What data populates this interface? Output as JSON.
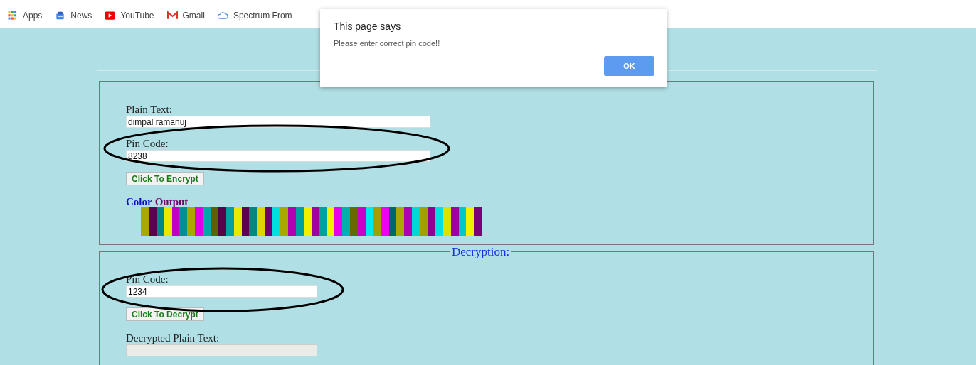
{
  "bookmarks_bar": {
    "items": [
      {
        "label": "Apps",
        "kind": "grid"
      },
      {
        "label": "News",
        "kind": "news"
      },
      {
        "label": "YouTube",
        "kind": "play"
      },
      {
        "label": "Gmail",
        "kind": "mail"
      },
      {
        "label": "Spectrum From",
        "kind": "cloud"
      }
    ]
  },
  "encryption": {
    "plain_text_label": "Plain Text:",
    "plain_text_value": "dimpal ramanuj",
    "pin_label": "Pin Code:",
    "pin_value": "8238",
    "button": "Click To Encrypt",
    "output_title_1": "Color",
    "output_title_2": "Output",
    "stripes": [
      {
        "color": "#a8a800"
      },
      {
        "color": "#5c0050"
      },
      {
        "color": "#008888"
      },
      {
        "color": "#e8e800"
      },
      {
        "color": "#c000c0"
      },
      {
        "color": "#009090"
      },
      {
        "color": "#a8a800"
      },
      {
        "color": "#e000e0"
      },
      {
        "color": "#00a8a8"
      },
      {
        "color": "#606000"
      },
      {
        "color": "#580048"
      },
      {
        "color": "#00a0a0"
      },
      {
        "color": "#e8e800"
      },
      {
        "color": "#600050"
      },
      {
        "color": "#008880"
      },
      {
        "color": "#d8d800"
      },
      {
        "color": "#700070"
      },
      {
        "color": "#00e0e0"
      },
      {
        "color": "#a8a800"
      },
      {
        "color": "#b000b0"
      },
      {
        "color": "#00a0a0"
      },
      {
        "color": "#f0f000"
      },
      {
        "color": "#a000a0"
      },
      {
        "color": "#00a0a0"
      },
      {
        "color": "#f0f000"
      },
      {
        "color": "#e800e8"
      },
      {
        "color": "#00b0b0"
      },
      {
        "color": "#686800"
      },
      {
        "color": "#c800c8"
      },
      {
        "color": "#00e8e8"
      },
      {
        "color": "#a0a000"
      },
      {
        "color": "#f000f0"
      },
      {
        "color": "#006868"
      },
      {
        "color": "#a8a800"
      },
      {
        "color": "#b000b0"
      },
      {
        "color": "#00d8d8"
      },
      {
        "color": "#a0a000"
      },
      {
        "color": "#900090"
      },
      {
        "color": "#00e0e0"
      },
      {
        "color": "#e0e000"
      },
      {
        "color": "#a000a0"
      },
      {
        "color": "#00c8c8"
      },
      {
        "color": "#f0f000"
      },
      {
        "color": "#800070"
      }
    ]
  },
  "decryption": {
    "legend": "Decryption:",
    "pin_label": "Pin Code:",
    "pin_value": "1234",
    "button": "Click To Decrypt",
    "result_label": "Decrypted Plain Text:",
    "result_disabled": true
  },
  "dialog": {
    "title": "This page says",
    "message": "Please enter correct pin code!!",
    "button": "OK"
  }
}
